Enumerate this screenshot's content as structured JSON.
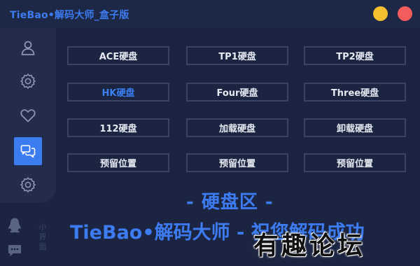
{
  "window": {
    "title": "TieBao•解码大师_盒子版"
  },
  "sidebar": {
    "items": [
      {
        "icon": "user-icon"
      },
      {
        "icon": "gear-icon"
      },
      {
        "icon": "heart-icon"
      },
      {
        "icon": "chat-icon",
        "active": true
      },
      {
        "icon": "gear-icon"
      }
    ],
    "vertical_text": "小界面"
  },
  "buttons": [
    {
      "label": "ACE硬盘"
    },
    {
      "label": "TP1硬盘"
    },
    {
      "label": "TP2硬盘"
    },
    {
      "label": "HK硬盘",
      "active": true
    },
    {
      "label": "Four硬盘"
    },
    {
      "label": "Three硬盘"
    },
    {
      "label": "112硬盘"
    },
    {
      "label": "加载硬盘"
    },
    {
      "label": "卸载硬盘"
    },
    {
      "label": "预留位置"
    },
    {
      "label": "预留位置"
    },
    {
      "label": "预留位置"
    }
  ],
  "main": {
    "zone_title": "- 硬盘区 -",
    "slogan": "TieBao•解码大师 - 祝您解码成功"
  },
  "watermark": "有趣论坛",
  "colors": {
    "accent": "#3d7bf0",
    "background": "#1b2541",
    "minimize": "#f5bf2f",
    "close": "#f25c5c"
  }
}
